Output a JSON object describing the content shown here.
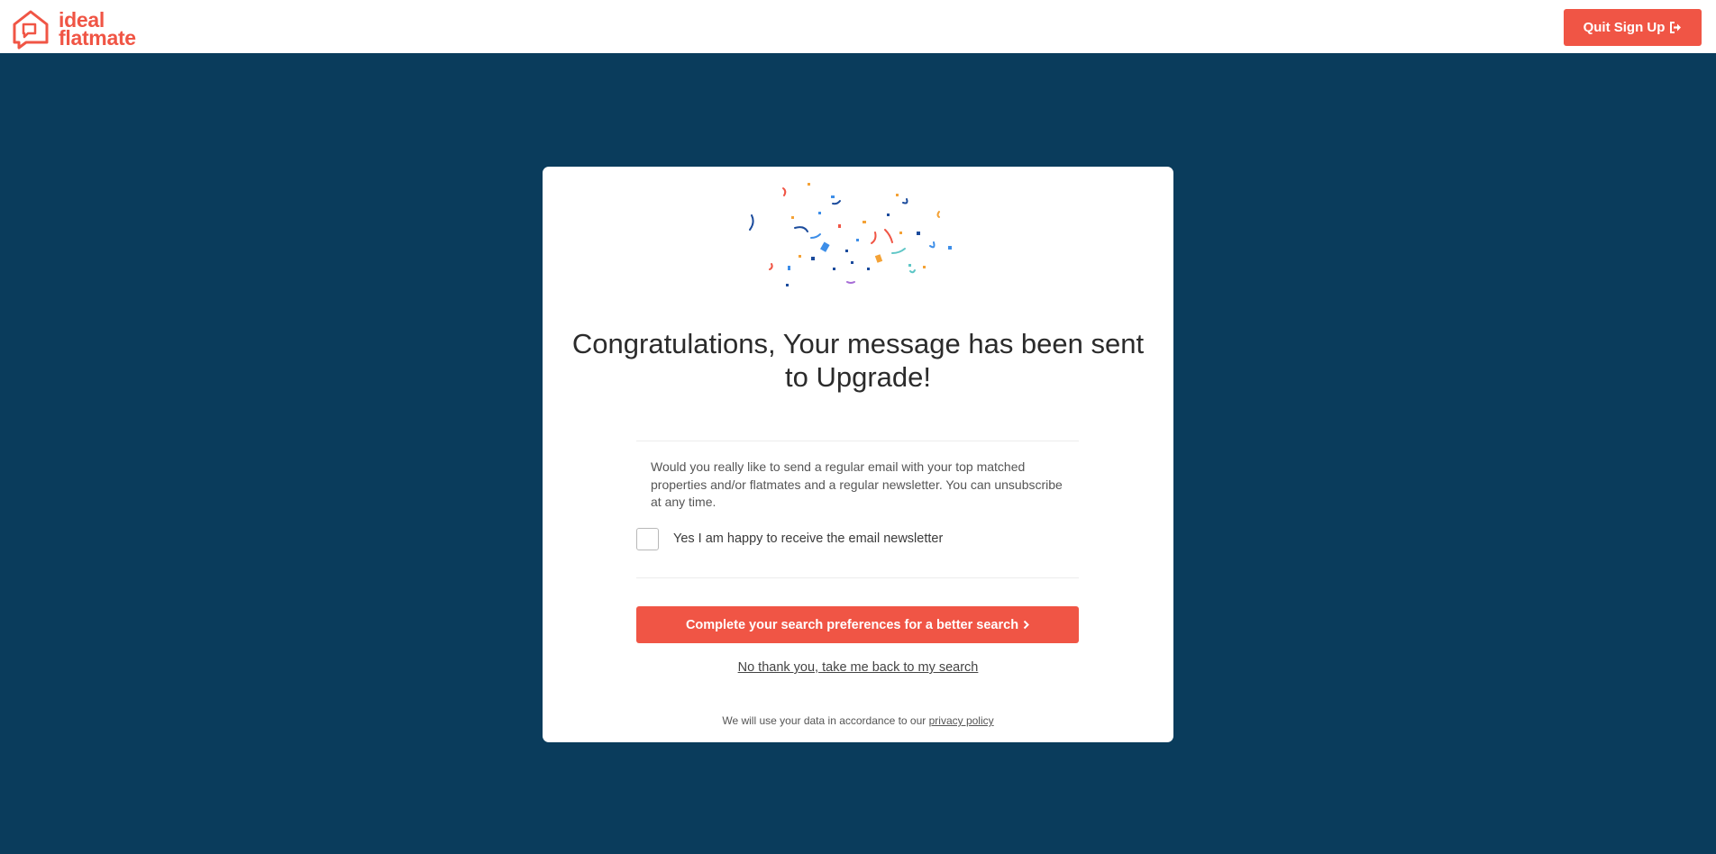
{
  "header": {
    "logo_line1": "ideal",
    "logo_line2": "flatmate",
    "quit_label": "Quit Sign Up",
    "quit_icon": "sign-out-icon"
  },
  "card": {
    "heading": "Congratulations, Your message has been sent to Upgrade!",
    "newsletter_prompt": "Would you really like to send a regular email with your top matched properties and/or flatmates and a regular newsletter. You can unsubscribe at any time.",
    "newsletter_checkbox_label": "Yes I am happy to receive the email newsletter",
    "newsletter_checked": false,
    "cta_label": "Complete your search preferences for a better search",
    "cta_icon": "chevron-right-icon",
    "back_link": "No thank you, take me back to my search",
    "privacy_prefix": "We will use your data in accordance to our",
    "privacy_link": "privacy policy"
  },
  "colors": {
    "brand": "#f05545",
    "background": "#0a3c5c",
    "card": "#ffffff"
  }
}
